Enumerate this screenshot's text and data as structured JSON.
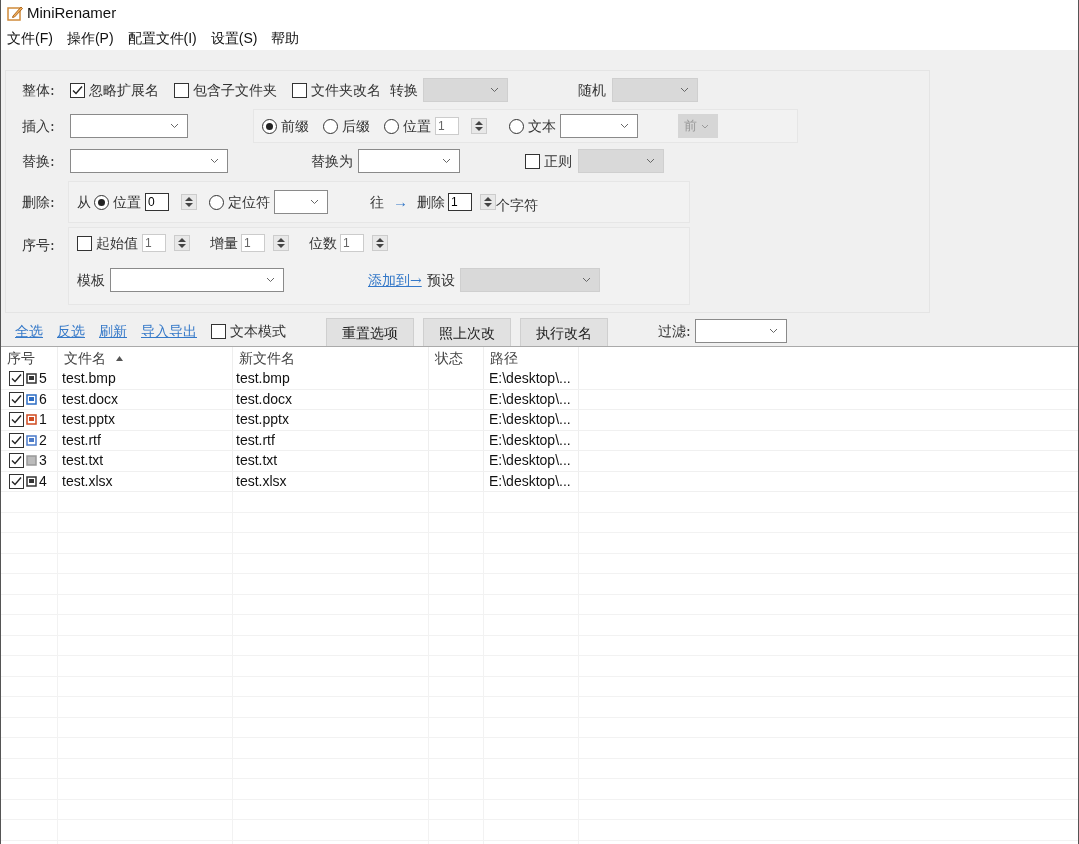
{
  "window": {
    "title": "MiniRenamer"
  },
  "menu": [
    {
      "label": "文件(F)"
    },
    {
      "label": "操作(P)"
    },
    {
      "label": "配置文件(I)"
    },
    {
      "label": "设置(S)"
    },
    {
      "label": "帮助"
    }
  ],
  "whole": {
    "label": "整体:",
    "checks": [
      {
        "label": "忽略扩展名",
        "checked": true
      },
      {
        "label": "包含子文件夹",
        "checked": false
      },
      {
        "label": "文件夹改名",
        "checked": false
      }
    ],
    "convert": {
      "label": "转换",
      "disabled": true
    },
    "random": {
      "label": "随机",
      "disabled": true
    }
  },
  "insert": {
    "label": "插入:",
    "radios": [
      {
        "label": "前缀",
        "selected": true
      },
      {
        "label": "后缀",
        "selected": false
      },
      {
        "label": "位置",
        "selected": false,
        "value": "1"
      },
      {
        "label": "文本",
        "selected": false
      }
    ],
    "side": {
      "label": "前",
      "disabled": true
    }
  },
  "replace": {
    "label": "替换:",
    "with_label": "替换为",
    "regex": {
      "label": "正则",
      "checked": false
    }
  },
  "delete": {
    "label": "删除:",
    "from": "从",
    "radios": [
      {
        "label": "位置",
        "selected": true,
        "value": "0"
      },
      {
        "label": "定位符",
        "selected": false
      }
    ],
    "direction_label": "往",
    "arrow": "→",
    "delete_label": "删除",
    "count": "1",
    "unit": "个字符"
  },
  "sequence": {
    "label": "序号:",
    "start": {
      "label": "起始值",
      "checked": false,
      "value": "1"
    },
    "step": {
      "label": "增量",
      "value": "1"
    },
    "digits": {
      "label": "位数",
      "value": "1"
    },
    "template_label": "模板",
    "add_link": "添加到→",
    "preset": {
      "label": "预设",
      "disabled": true
    }
  },
  "actions": {
    "links": [
      "全选",
      "反选",
      "刷新",
      "导入导出"
    ],
    "text_mode": {
      "label": "文本模式",
      "checked": false
    },
    "buttons": [
      "重置选项",
      "照上次改",
      "执行改名"
    ],
    "filter_label": "过滤:"
  },
  "table": {
    "columns": [
      {
        "label": "序号",
        "sorted": false
      },
      {
        "label": "文件名",
        "sorted": true
      },
      {
        "label": "新文件名",
        "sorted": false
      },
      {
        "label": "状态",
        "sorted": false
      },
      {
        "label": "路径",
        "sorted": false
      }
    ],
    "rows": [
      {
        "checked": true,
        "kind": "image",
        "index": "5",
        "name": "test.bmp",
        "new_name": "test.bmp",
        "path": "E:\\desktop\\..."
      },
      {
        "checked": true,
        "kind": "word",
        "index": "6",
        "name": "test.docx",
        "new_name": "test.docx",
        "path": "E:\\desktop\\..."
      },
      {
        "checked": true,
        "kind": "slides",
        "index": "1",
        "name": "test.pptx",
        "new_name": "test.pptx",
        "path": "E:\\desktop\\..."
      },
      {
        "checked": true,
        "kind": "rich",
        "index": "2",
        "name": "test.rtf",
        "new_name": "test.rtf",
        "path": "E:\\desktop\\..."
      },
      {
        "checked": true,
        "kind": "text",
        "index": "3",
        "name": "test.txt",
        "new_name": "test.txt",
        "path": "E:\\desktop\\..."
      },
      {
        "checked": true,
        "kind": "sheet",
        "index": "4",
        "name": "test.xlsx",
        "new_name": "test.xlsx",
        "path": "E:\\desktop\\..."
      }
    ]
  }
}
